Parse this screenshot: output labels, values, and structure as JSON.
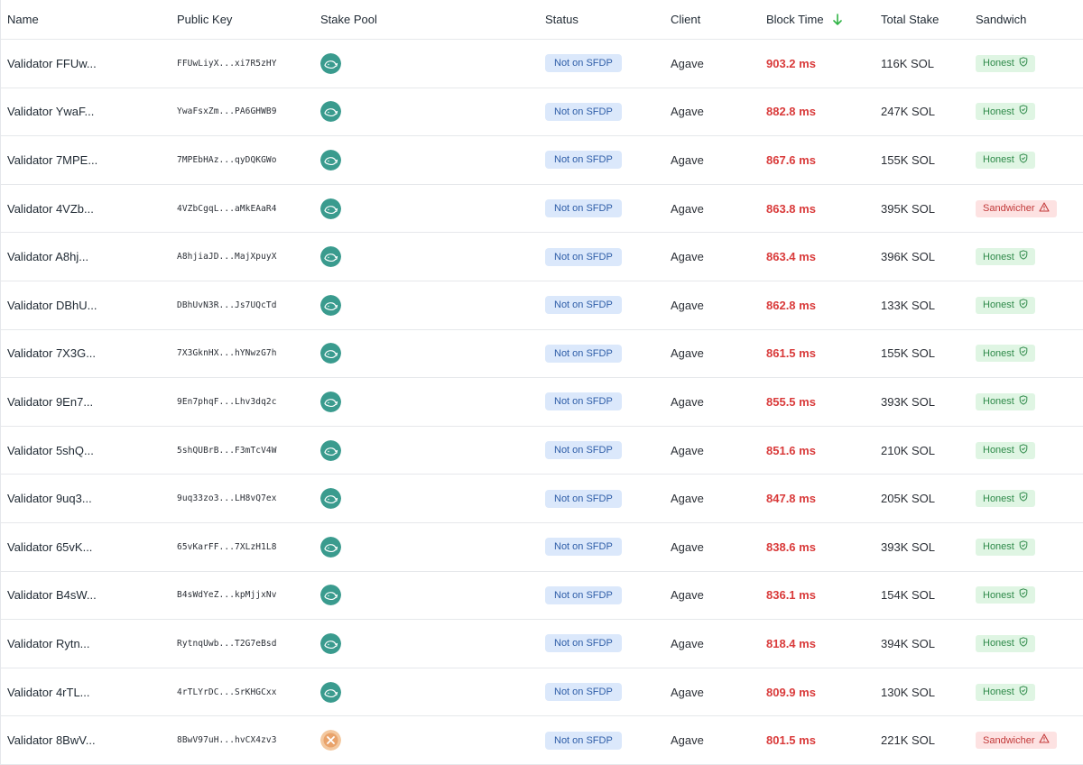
{
  "columns": {
    "name": "Name",
    "public_key": "Public Key",
    "stake_pool": "Stake Pool",
    "status": "Status",
    "client": "Client",
    "block_time": "Block Time",
    "total_stake": "Total Stake",
    "sandwich": "Sandwich"
  },
  "sort": {
    "column": "block_time",
    "direction": "descending",
    "icon": "arrow-down-icon",
    "color": "#2fb344"
  },
  "colors": {
    "block_time": "#d93a3a",
    "status_badge_bg": "#dbe8fb",
    "status_badge_fg": "#2f5ea8",
    "honest_bg": "#dff5e3",
    "honest_fg": "#2f8a4a",
    "sandwicher_bg": "#fde2e2",
    "sandwicher_fg": "#c23a3a",
    "pool_teal": "#3a9b8e",
    "pool_orange": "#e9a36b"
  },
  "rows": [
    {
      "name": "Validator FFUw...",
      "public_key": "FFUwLiyX...xi7R5zHY",
      "stake_pool": "teal-whale-icon",
      "status": "Not on SFDP",
      "client": "Agave",
      "block_time": "903.2 ms",
      "total_stake": "116K SOL",
      "sandwich": "Honest",
      "sandwich_type": "honest"
    },
    {
      "name": "Validator YwaF...",
      "public_key": "YwaFsxZm...PA6GHWB9",
      "stake_pool": "teal-whale-icon",
      "status": "Not on SFDP",
      "client": "Agave",
      "block_time": "882.8 ms",
      "total_stake": "247K SOL",
      "sandwich": "Honest",
      "sandwich_type": "honest"
    },
    {
      "name": "Validator 7MPE...",
      "public_key": "7MPEbHAz...qyDQKGWo",
      "stake_pool": "teal-whale-icon",
      "status": "Not on SFDP",
      "client": "Agave",
      "block_time": "867.6 ms",
      "total_stake": "155K SOL",
      "sandwich": "Honest",
      "sandwich_type": "honest"
    },
    {
      "name": "Validator 4VZb...",
      "public_key": "4VZbCgqL...aMkEAaR4",
      "stake_pool": "teal-whale-icon",
      "status": "Not on SFDP",
      "client": "Agave",
      "block_time": "863.8 ms",
      "total_stake": "395K SOL",
      "sandwich": "Sandwicher",
      "sandwich_type": "sandwicher"
    },
    {
      "name": "Validator A8hj...",
      "public_key": "A8hjiaJD...MajXpuyX",
      "stake_pool": "teal-whale-icon",
      "status": "Not on SFDP",
      "client": "Agave",
      "block_time": "863.4 ms",
      "total_stake": "396K SOL",
      "sandwich": "Honest",
      "sandwich_type": "honest"
    },
    {
      "name": "Validator DBhU...",
      "public_key": "DBhUvN3R...Js7UQcTd",
      "stake_pool": "teal-whale-icon",
      "status": "Not on SFDP",
      "client": "Agave",
      "block_time": "862.8 ms",
      "total_stake": "133K SOL",
      "sandwich": "Honest",
      "sandwich_type": "honest"
    },
    {
      "name": "Validator 7X3G...",
      "public_key": "7X3GknHX...hYNwzG7h",
      "stake_pool": "teal-whale-icon",
      "status": "Not on SFDP",
      "client": "Agave",
      "block_time": "861.5 ms",
      "total_stake": "155K SOL",
      "sandwich": "Honest",
      "sandwich_type": "honest"
    },
    {
      "name": "Validator 9En7...",
      "public_key": "9En7phqF...Lhv3dq2c",
      "stake_pool": "teal-whale-icon",
      "status": "Not on SFDP",
      "client": "Agave",
      "block_time": "855.5 ms",
      "total_stake": "393K SOL",
      "sandwich": "Honest",
      "sandwich_type": "honest"
    },
    {
      "name": "Validator 5shQ...",
      "public_key": "5shQUBrB...F3mTcV4W",
      "stake_pool": "teal-whale-icon",
      "status": "Not on SFDP",
      "client": "Agave",
      "block_time": "851.6 ms",
      "total_stake": "210K SOL",
      "sandwich": "Honest",
      "sandwich_type": "honest"
    },
    {
      "name": "Validator 9uq3...",
      "public_key": "9uq33zo3...LH8vQ7ex",
      "stake_pool": "teal-whale-icon",
      "status": "Not on SFDP",
      "client": "Agave",
      "block_time": "847.8 ms",
      "total_stake": "205K SOL",
      "sandwich": "Honest",
      "sandwich_type": "honest"
    },
    {
      "name": "Validator 65vK...",
      "public_key": "65vKarFF...7XLzH1L8",
      "stake_pool": "teal-whale-icon",
      "status": "Not on SFDP",
      "client": "Agave",
      "block_time": "838.6 ms",
      "total_stake": "393K SOL",
      "sandwich": "Honest",
      "sandwich_type": "honest"
    },
    {
      "name": "Validator B4sW...",
      "public_key": "B4sWdYeZ...kpMjjxNv",
      "stake_pool": "teal-whale-icon",
      "status": "Not on SFDP",
      "client": "Agave",
      "block_time": "836.1 ms",
      "total_stake": "154K SOL",
      "sandwich": "Honest",
      "sandwich_type": "honest"
    },
    {
      "name": "Validator Rytn...",
      "public_key": "RytnqUwb...T2G7eBsd",
      "stake_pool": "teal-whale-icon",
      "status": "Not on SFDP",
      "client": "Agave",
      "block_time": "818.4 ms",
      "total_stake": "394K SOL",
      "sandwich": "Honest",
      "sandwich_type": "honest"
    },
    {
      "name": "Validator 4rTL...",
      "public_key": "4rTLYrDC...SrKHGCxx",
      "stake_pool": "teal-whale-icon",
      "status": "Not on SFDP",
      "client": "Agave",
      "block_time": "809.9 ms",
      "total_stake": "130K SOL",
      "sandwich": "Honest",
      "sandwich_type": "honest"
    },
    {
      "name": "Validator 8BwV...",
      "public_key": "8BwV97uH...hvCX4zv3",
      "stake_pool": "orange-pool-icon",
      "status": "Not on SFDP",
      "client": "Agave",
      "block_time": "801.5 ms",
      "total_stake": "221K SOL",
      "sandwich": "Sandwicher",
      "sandwich_type": "sandwicher"
    }
  ]
}
